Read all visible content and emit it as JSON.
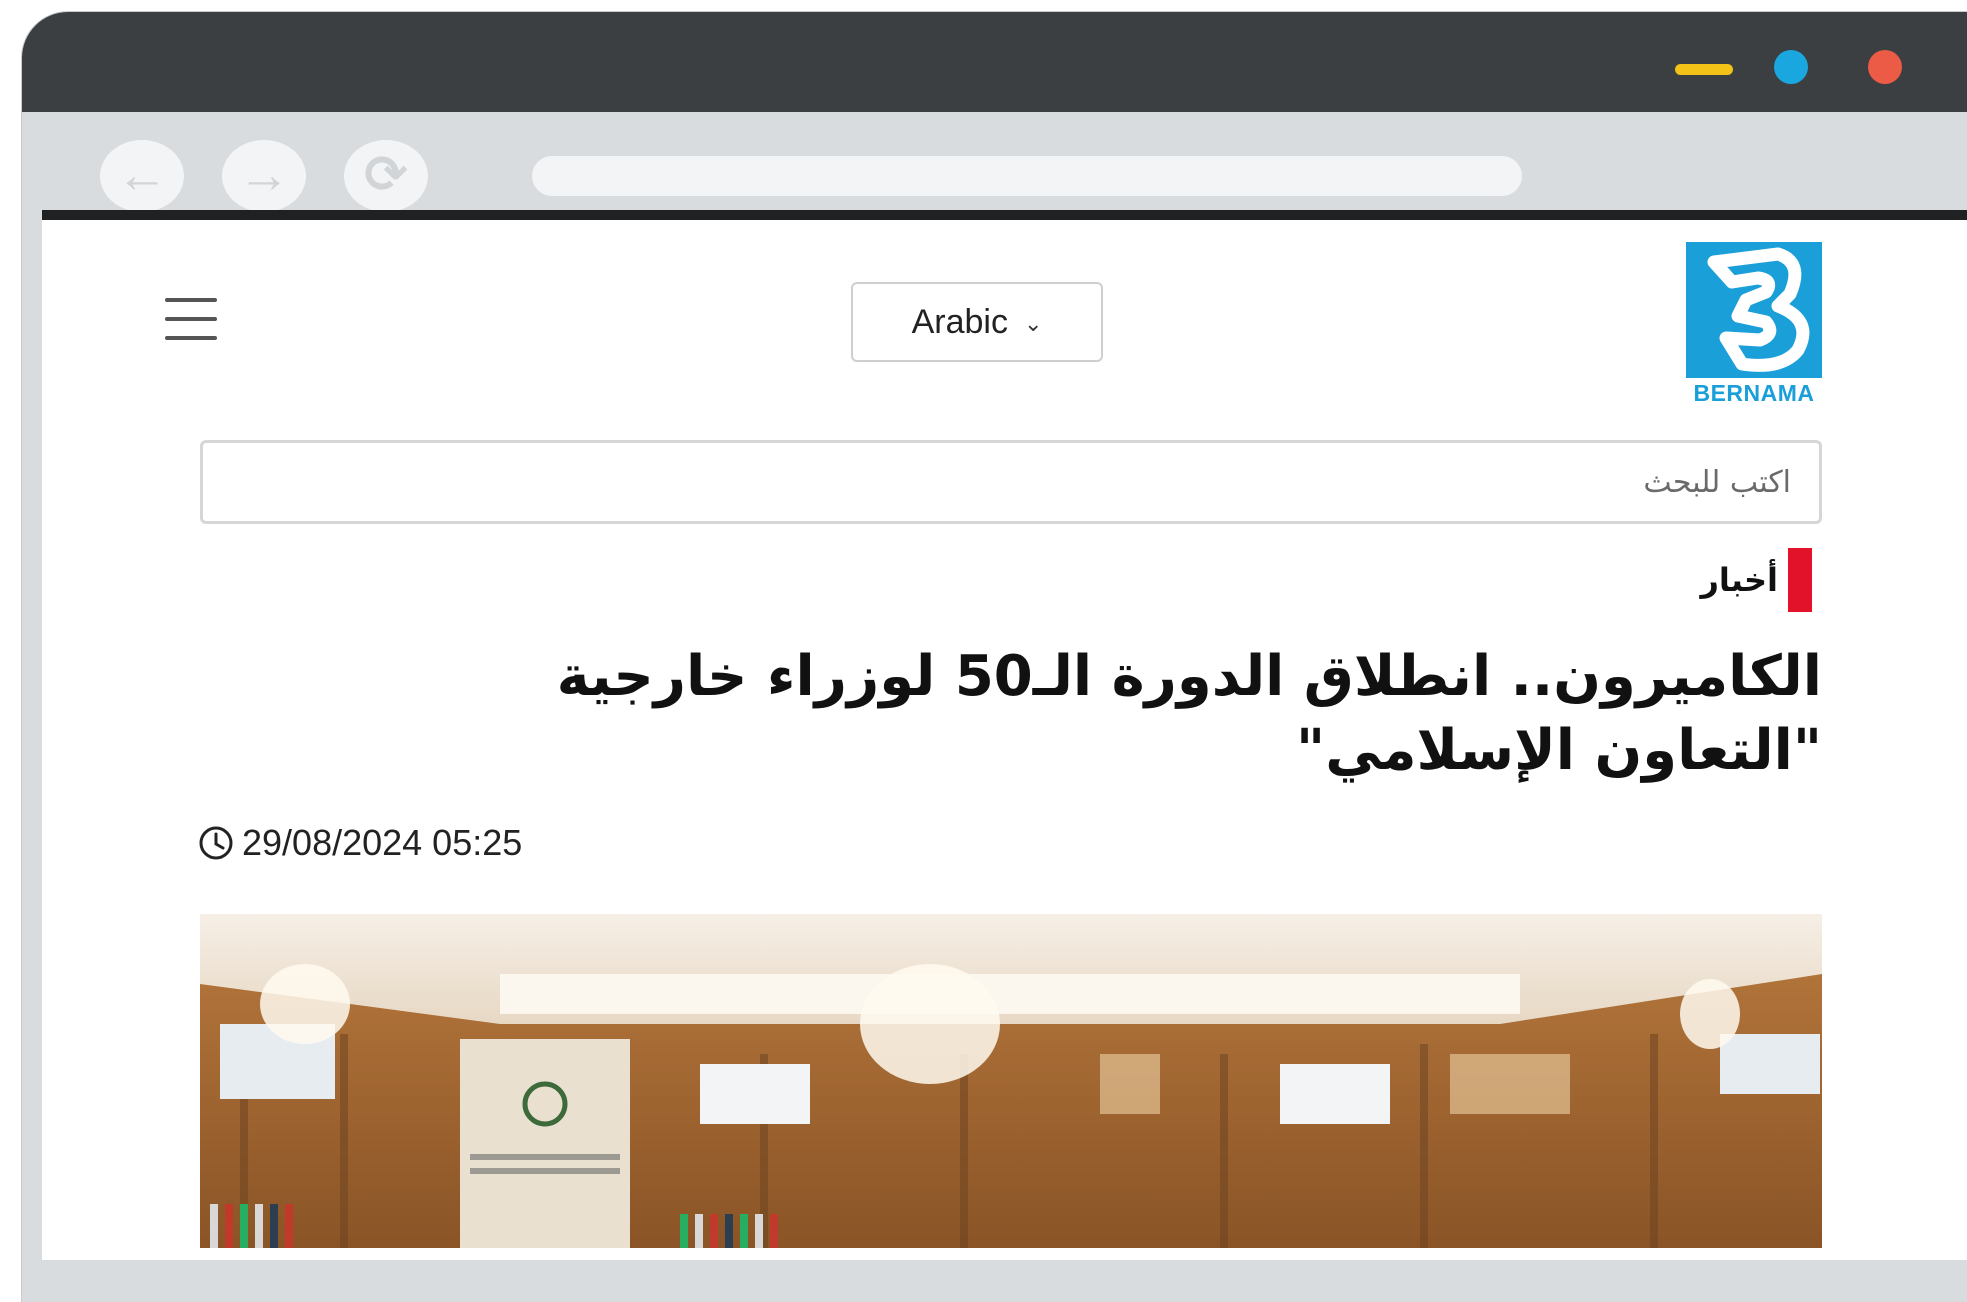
{
  "window": {
    "controls": [
      "minimize-icon",
      "maximize-icon",
      "close-icon"
    ],
    "colors": {
      "minimize": "#f3c317",
      "maximize": "#1aa7e0",
      "close": "#ec5b45"
    }
  },
  "toolbar": {
    "back_icon": "←",
    "forward_icon": "→",
    "reload_icon": "⟳"
  },
  "header": {
    "language": "Arabic",
    "language_chevron": "⌄",
    "logo_text": "BERNAMA",
    "brand_color": "#1b9fd9"
  },
  "search": {
    "placeholder": "اكتب للبحث",
    "value": ""
  },
  "article": {
    "category": "أخبار",
    "category_color": "#e2122b",
    "headline": "الكاميرون.. انطلاق الدورة الـ50 لوزراء خارجية \"التعاون الإسلامي\"",
    "timestamp": "29/08/2024 05:25"
  }
}
